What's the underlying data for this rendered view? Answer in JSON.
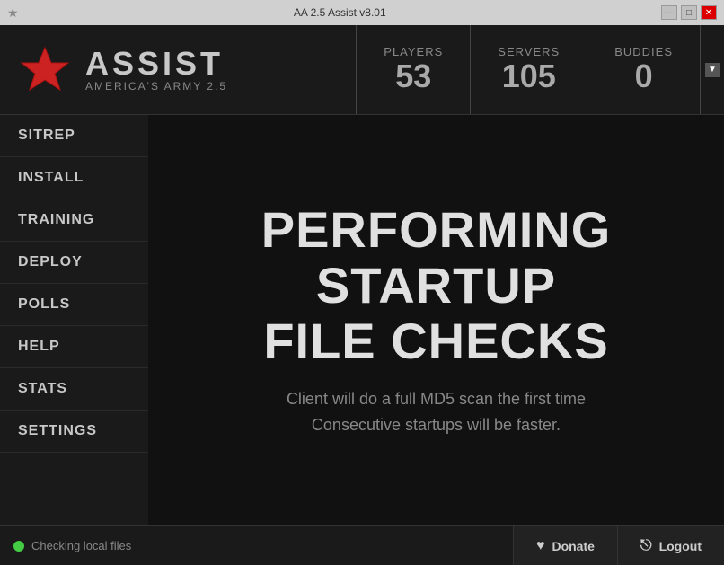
{
  "window": {
    "title": "AA 2.5 Assist v8.01",
    "min_btn": "—",
    "max_btn": "□",
    "close_btn": "✕"
  },
  "logo": {
    "title": "ASSIST",
    "subtitle": "AMERICA'S ARMY 2.5"
  },
  "stats": {
    "players_label": "Players",
    "players_value": "53",
    "servers_label": "Servers",
    "servers_value": "105",
    "buddies_label": "Buddies",
    "buddies_value": "0"
  },
  "sidebar": {
    "items": [
      {
        "id": "sitrep",
        "label": "SITREP"
      },
      {
        "id": "install",
        "label": "INSTALL"
      },
      {
        "id": "training",
        "label": "TRAINING"
      },
      {
        "id": "deploy",
        "label": "DEPLOY"
      },
      {
        "id": "polls",
        "label": "POLLS"
      },
      {
        "id": "help",
        "label": "HELP"
      },
      {
        "id": "stats",
        "label": "STATS"
      },
      {
        "id": "settings",
        "label": "SETTINGS"
      }
    ]
  },
  "content": {
    "heading_line1": "PERFORMING STARTUP",
    "heading_line2": "FILE CHECKS",
    "subtext_line1": "Client will do a full MD5 scan the first time",
    "subtext_line2": "Consecutive startups will be faster."
  },
  "footer": {
    "status_text": "Checking local files",
    "donate_label": "Donate",
    "logout_label": "Logout"
  }
}
